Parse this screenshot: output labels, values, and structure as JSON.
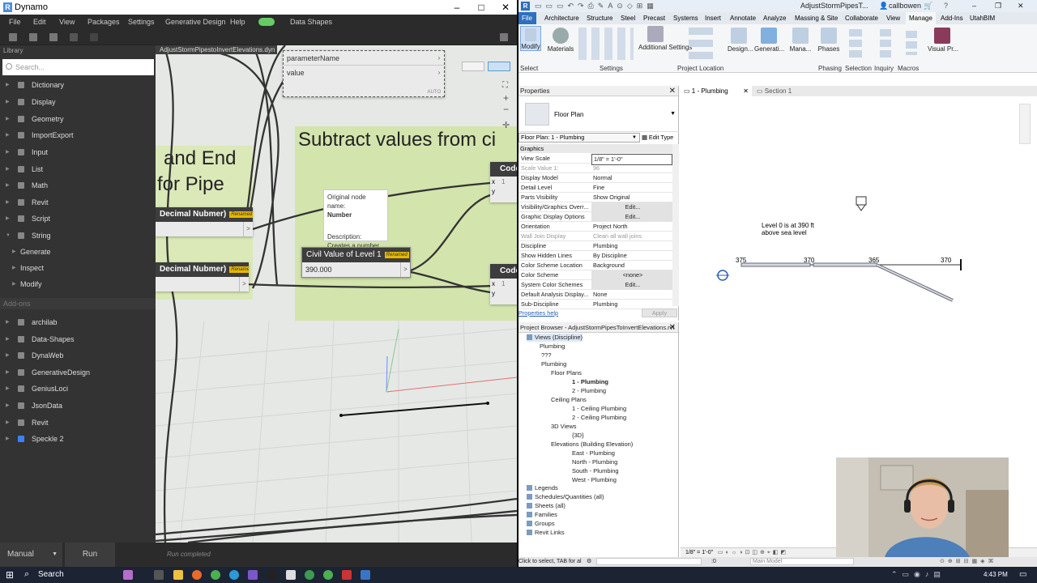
{
  "dynamo": {
    "title": "Dynamo",
    "menu": [
      "File",
      "Edit",
      "View",
      "Packages",
      "Settings",
      "Generative Design",
      "Help",
      "Data Shapes"
    ],
    "tab_title": "AdjustStormPipestoInvertElevations.dyn",
    "library": {
      "header": "Library",
      "search_placeholder": "Search...",
      "categories": [
        "Dictionary",
        "Display",
        "Geometry",
        "ImportExport",
        "Input",
        "List",
        "Math",
        "Revit",
        "Script",
        "String"
      ],
      "sub_items": [
        "Generate",
        "Inspect",
        "Modify"
      ],
      "addons_header": "Add-ons",
      "addons": [
        "archilab",
        "Data-Shapes",
        "DynaWeb",
        "GenerativeDesign",
        "GeniusLoci",
        "JsonData",
        "Revit",
        "Speckle 2"
      ]
    },
    "canvas": {
      "group1_title_line1": "and End",
      "group1_title_line2": "for Pipe",
      "group2_title": "Subtract values from ci",
      "top_node_ports": [
        "parameterName",
        "value"
      ],
      "top_node_mode": "AUTO",
      "node_decimal_1": "Decimal Nubmer)",
      "node_decimal_2": "Decimal Nubmer)",
      "badge": "Renamed",
      "civil_node_title": "Civil Value of Level 1",
      "civil_node_value": "390.000",
      "code_node_label": "Code",
      "code_port_x": "x",
      "code_port_y": "y",
      "code_line_num": "1",
      "tooltip_label": "Original node name:",
      "tooltip_name": "Number",
      "tooltip_desc_label": "Description:",
      "tooltip_desc": "Creates a number."
    },
    "status": {
      "run_mode": "Manual",
      "run_button": "Run",
      "run_status": "Run completed"
    }
  },
  "revit": {
    "title": "AdjustStormPipesT...",
    "user": "callbowen",
    "tabs": [
      "File",
      "Architecture",
      "Structure",
      "Steel",
      "Precast",
      "Systems",
      "Insert",
      "Annotate",
      "Analyze",
      "Massing & Site",
      "Collaborate",
      "View",
      "Manage",
      "Add-Ins",
      "UtahBIM"
    ],
    "active_tab": "Manage",
    "ribbon_buttons": [
      "Modify",
      "Materials",
      "Additional Settings",
      "Design...",
      "Generati...",
      "Mana...",
      "Phases",
      "Selection",
      "Inquiry",
      "Macros",
      "Visual Pr..."
    ],
    "ribbon_groups": [
      "Select",
      "Settings",
      "Project Location",
      "Phasing",
      "Selection",
      "Inquiry",
      "Macros"
    ],
    "properties": {
      "title": "Properties",
      "type": "Floor Plan",
      "selector": "Floor Plan: 1 - Plumbing",
      "edit_type": "Edit Type",
      "section": "Graphics",
      "rows": [
        {
          "k": "View Scale",
          "v": "1/8\" = 1'-0\""
        },
        {
          "k": "Scale Value    1:",
          "v": "96",
          "dis": true
        },
        {
          "k": "Display Model",
          "v": "Normal"
        },
        {
          "k": "Detail Level",
          "v": "Fine"
        },
        {
          "k": "Parts Visibility",
          "v": "Show Original"
        },
        {
          "k": "Visibility/Graphics Overr...",
          "v": "Edit...",
          "btn": true
        },
        {
          "k": "Graphic Display Options",
          "v": "Edit...",
          "btn": true
        },
        {
          "k": "Orientation",
          "v": "Project North"
        },
        {
          "k": "Wall Join Display",
          "v": "Clean all wall joins",
          "dis": true
        },
        {
          "k": "Discipline",
          "v": "Plumbing"
        },
        {
          "k": "Show Hidden Lines",
          "v": "By Discipline"
        },
        {
          "k": "Color Scheme Location",
          "v": "Background"
        },
        {
          "k": "Color Scheme",
          "v": "<none>",
          "btn": true
        },
        {
          "k": "System Color Schemes",
          "v": "Edit...",
          "btn": true
        },
        {
          "k": "Default Analysis Display...",
          "v": "None"
        },
        {
          "k": "Sub-Discipline",
          "v": "Plumbing"
        }
      ],
      "help": "Properties help",
      "apply": "Apply"
    },
    "browser": {
      "title": "Project Browser - AdjustStormPipesToInvertElevations.rvt",
      "items": [
        {
          "t": "Views (Discipline)",
          "lvl": 0
        },
        {
          "t": "Plumbing",
          "lvl": 1
        },
        {
          "t": "???",
          "lvl": 2
        },
        {
          "t": "Plumbing",
          "lvl": 2
        },
        {
          "t": "Floor Plans",
          "lvl": 3
        },
        {
          "t": "1 - Plumbing",
          "lvl": 4,
          "bold": true
        },
        {
          "t": "2 - Plumbing",
          "lvl": 4
        },
        {
          "t": "Ceiling Plans",
          "lvl": 3
        },
        {
          "t": "1 - Ceiling Plumbing",
          "lvl": 4
        },
        {
          "t": "2 - Ceiling Plumbing",
          "lvl": 4
        },
        {
          "t": "3D Views",
          "lvl": 3
        },
        {
          "t": "{3D}",
          "lvl": 4
        },
        {
          "t": "Elevations (Building Elevation)",
          "lvl": 3
        },
        {
          "t": "East - Plumbing",
          "lvl": 4
        },
        {
          "t": "North - Plumbing",
          "lvl": 4
        },
        {
          "t": "South - Plumbing",
          "lvl": 4
        },
        {
          "t": "West - Plumbing",
          "lvl": 4
        },
        {
          "t": "Legends",
          "lvl": 0
        },
        {
          "t": "Schedules/Quantities (all)",
          "lvl": 0
        },
        {
          "t": "Sheets (all)",
          "lvl": 0
        },
        {
          "t": "Families",
          "lvl": 0
        },
        {
          "t": "Groups",
          "lvl": 0
        },
        {
          "t": "Revit Links",
          "lvl": 0
        }
      ]
    },
    "view_tabs": [
      "1 - Plumbing",
      "Section 1"
    ],
    "annotation_line1": "Level 0 is at 390 ft",
    "annotation_line2": "above sea level",
    "elevation_labels": [
      "375",
      "370",
      "365",
      "370"
    ],
    "view_scale": "1/8\" = 1'-0\"",
    "status_text": "Click to select, TAB for al",
    "status_zero": ":0",
    "status_model": "Main Model"
  },
  "taskbar": {
    "search": "Search",
    "time": "4:43 PM"
  }
}
